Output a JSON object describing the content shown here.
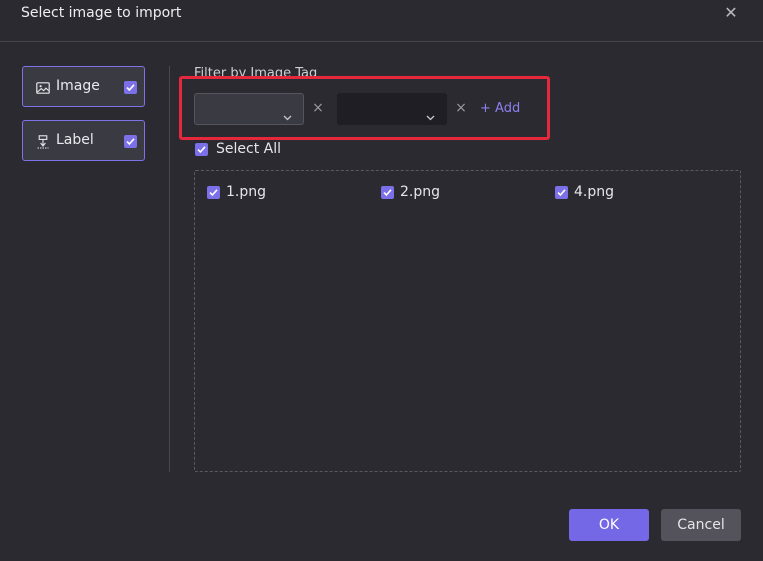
{
  "dialog": {
    "title": "Select image to import",
    "close_glyph": "✕"
  },
  "sidebar": {
    "items": [
      {
        "label": "Image",
        "icon": "image-icon",
        "checked": true
      },
      {
        "label": "Label",
        "icon": "label-icon",
        "checked": true
      }
    ]
  },
  "filter": {
    "label": "Filter by Image Tag",
    "selects": [
      {
        "value": ""
      },
      {
        "value": ""
      }
    ],
    "remove_glyph": "×",
    "add_label": "+ Add"
  },
  "files": {
    "select_all_label": "Select All",
    "select_all_checked": true,
    "items": [
      {
        "name": "1.png",
        "checked": true
      },
      {
        "name": "2.png",
        "checked": true
      },
      {
        "name": "4.png",
        "checked": true
      }
    ]
  },
  "footer": {
    "ok_label": "OK",
    "cancel_label": "Cancel"
  },
  "colors": {
    "accent": "#7b70e8",
    "highlight": "#e5283b",
    "background": "#2b2a30"
  }
}
